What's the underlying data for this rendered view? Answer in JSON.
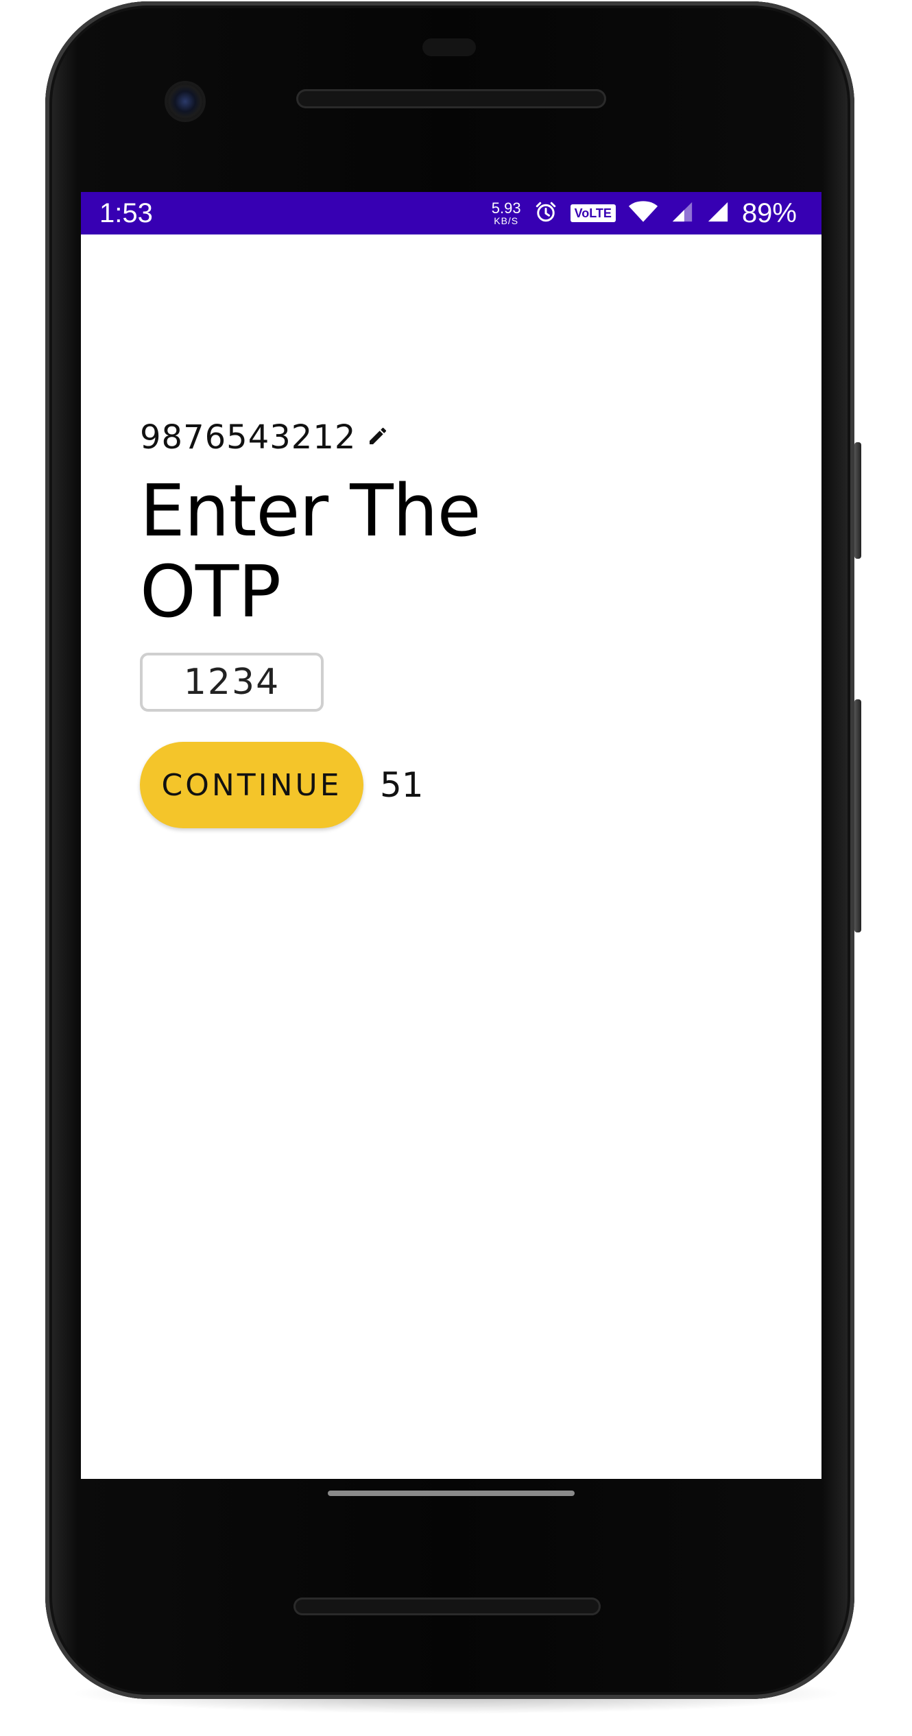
{
  "status_bar": {
    "time": "1:53",
    "net_speed_value": "5.93",
    "net_speed_unit": "KB/S",
    "volte_label": "VoLTE",
    "battery_percent": "89%",
    "background_color": "#3700b3"
  },
  "icons": {
    "alarm": "alarm-icon",
    "wifi": "wifi-icon",
    "signal_1": "signal-icon",
    "signal_2": "signal-icon",
    "edit": "pencil-icon"
  },
  "otp_screen": {
    "phone_number": "9876543212",
    "title": "Enter The OTP",
    "otp_value": "1234",
    "continue_label": "CONTINUE",
    "countdown": "51",
    "accent_color": "#f4c52a"
  }
}
